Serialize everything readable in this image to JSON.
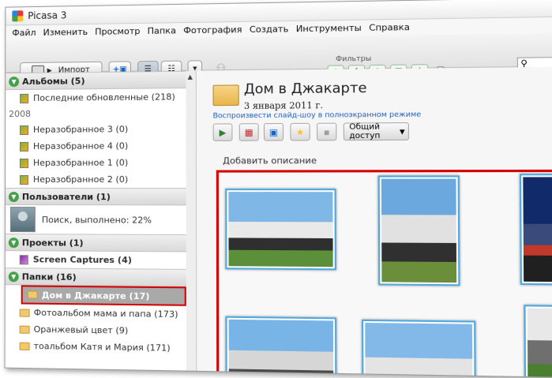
{
  "window": {
    "title": "Picasa 3"
  },
  "menu": [
    "Файл",
    "Изменить",
    "Просмотр",
    "Папка",
    "Фотография",
    "Создать",
    "Инструменты",
    "Справка"
  ],
  "toolbar": {
    "import_label": "Импорт",
    "filters_label": "Фильтры",
    "filter_icons": [
      "star-icon",
      "arrow-up-icon",
      "person-icon",
      "film-icon",
      "pin-icon"
    ]
  },
  "sidebar": {
    "albums_header": "Альбомы (5)",
    "recent_updates": "Последние обновленные (218)",
    "year": "2008",
    "albums": [
      "Неразобранное 3 (0)",
      "Неразобранное 4 (0)",
      "Неразобранное 1 (0)",
      "Неразобранное 2 (0)"
    ],
    "people_header": "Пользователи (1)",
    "people_search": "Поиск, выполнено: 22%",
    "projects_header": "Проекты (1)",
    "screen_captures": "Screen Captures (4)",
    "folders_header": "Папки (16)",
    "folders": [
      "Дом в Джакарте (17)",
      "Фотоальбом мама и папа (173)",
      "Оранжевый цвет (9)",
      "тоальбом Катя и Мария (171)"
    ]
  },
  "album": {
    "title": "Дом в Джакарте",
    "date": "3 января 2011 г.",
    "slideshow_link": "Воспроизвести слайд-шоу в полноэкранном режиме",
    "share_label": "Общий доступ",
    "add_description": "Добавить описание"
  },
  "colors": {
    "highlight_red": "#d50000",
    "thumb_border": "#4fa9e0",
    "section_green": "#43a047",
    "link_blue": "#1f5fbf"
  }
}
